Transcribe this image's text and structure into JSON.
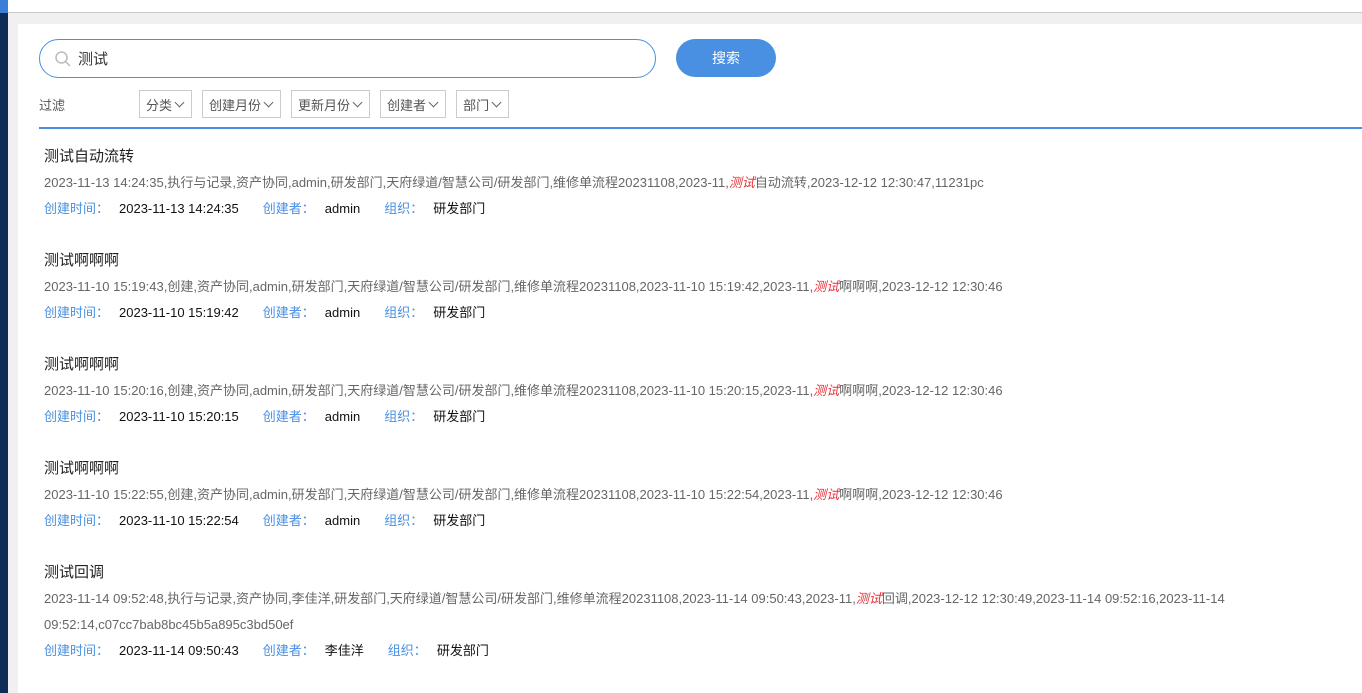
{
  "search": {
    "value": "测试",
    "button": "搜索"
  },
  "filters": {
    "label": "过滤",
    "options": [
      "分类",
      "创建月份",
      "更新月份",
      "创建者",
      "部门"
    ]
  },
  "labels": {
    "created_time": "创建时间：",
    "creator": "创建者：",
    "org": "组织："
  },
  "accent": "#4a90e2",
  "highlight": "#e8333a",
  "results": [
    {
      "title": "测试自动流转",
      "pre": "2023-11-13 14:24:35,执行与记录,资产协同,admin,研发部门,天府绿道/智慧公司/研发部门,维修单流程20231108,2023-11,",
      "hl": "测试",
      "post": "自动流转,2023-12-12 12:30:47,11231pc",
      "time": "2023-11-13 14:24:35",
      "creator": "admin",
      "org": "研发部门"
    },
    {
      "title": "测试啊啊啊",
      "pre": "2023-11-10 15:19:43,创建,资产协同,admin,研发部门,天府绿道/智慧公司/研发部门,维修单流程20231108,2023-11-10 15:19:42,2023-11,",
      "hl": "测试",
      "post": "啊啊啊,2023-12-12 12:30:46",
      "time": "2023-11-10 15:19:42",
      "creator": "admin",
      "org": "研发部门"
    },
    {
      "title": "测试啊啊啊",
      "pre": "2023-11-10 15:20:16,创建,资产协同,admin,研发部门,天府绿道/智慧公司/研发部门,维修单流程20231108,2023-11-10 15:20:15,2023-11,",
      "hl": "测试",
      "post": "啊啊啊,2023-12-12 12:30:46",
      "time": "2023-11-10 15:20:15",
      "creator": "admin",
      "org": "研发部门"
    },
    {
      "title": "测试啊啊啊",
      "pre": "2023-11-10 15:22:55,创建,资产协同,admin,研发部门,天府绿道/智慧公司/研发部门,维修单流程20231108,2023-11-10 15:22:54,2023-11,",
      "hl": "测试",
      "post": "啊啊啊,2023-12-12 12:30:46",
      "time": "2023-11-10 15:22:54",
      "creator": "admin",
      "org": "研发部门"
    },
    {
      "title": "测试回调",
      "pre": "2023-11-14 09:52:48,执行与记录,资产协同,李佳洋,研发部门,天府绿道/智慧公司/研发部门,维修单流程20231108,2023-11-14 09:50:43,2023-11,",
      "hl": "测试",
      "post": "回调,2023-12-12 12:30:49,2023-11-14 09:52:16,2023-11-14 09:52:14,c07cc7bab8bc45b5a895c3bd50ef",
      "time": "2023-11-14 09:50:43",
      "creator": "李佳洋",
      "org": "研发部门"
    }
  ]
}
